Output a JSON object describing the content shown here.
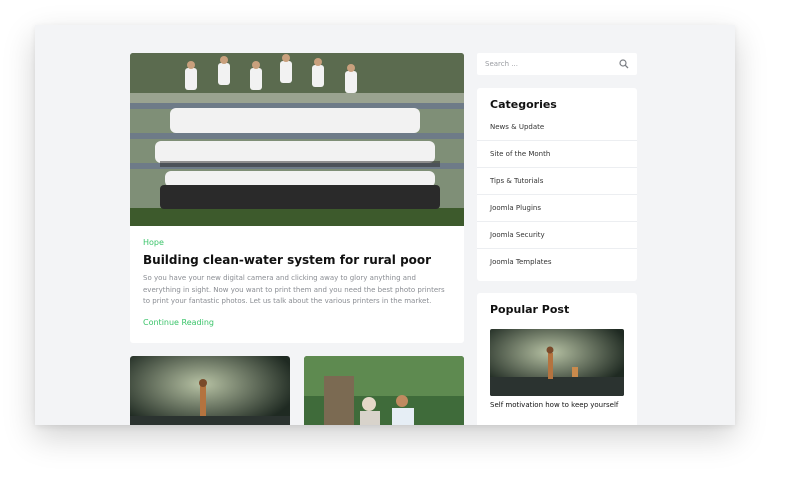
{
  "main_post": {
    "category": "Hope",
    "title": "Building clean-water system for rural poor",
    "excerpt": "So you have your new digital camera and clicking away to glory anything and everything in sight. Now you want to print them and you need the best photo printers to print your fantastic photos. Let us talk about the various printers in the market.",
    "read_more": "Continue Reading"
  },
  "search": {
    "placeholder": "Search ..."
  },
  "categories": {
    "title": "Categories",
    "items": [
      {
        "label": "News & Update"
      },
      {
        "label": "Site of the Month"
      },
      {
        "label": "Tips & Tutorials"
      },
      {
        "label": "Joomla Plugins"
      },
      {
        "label": "Joomla Security"
      },
      {
        "label": "Joomla Templates"
      }
    ]
  },
  "popular_post": {
    "title": "Popular Post",
    "items": [
      {
        "title": "Self motivation how to keep yourself"
      }
    ]
  },
  "colors": {
    "accent": "#3bc46a",
    "page_bg": "#f3f4f6",
    "card_bg": "#ffffff"
  }
}
